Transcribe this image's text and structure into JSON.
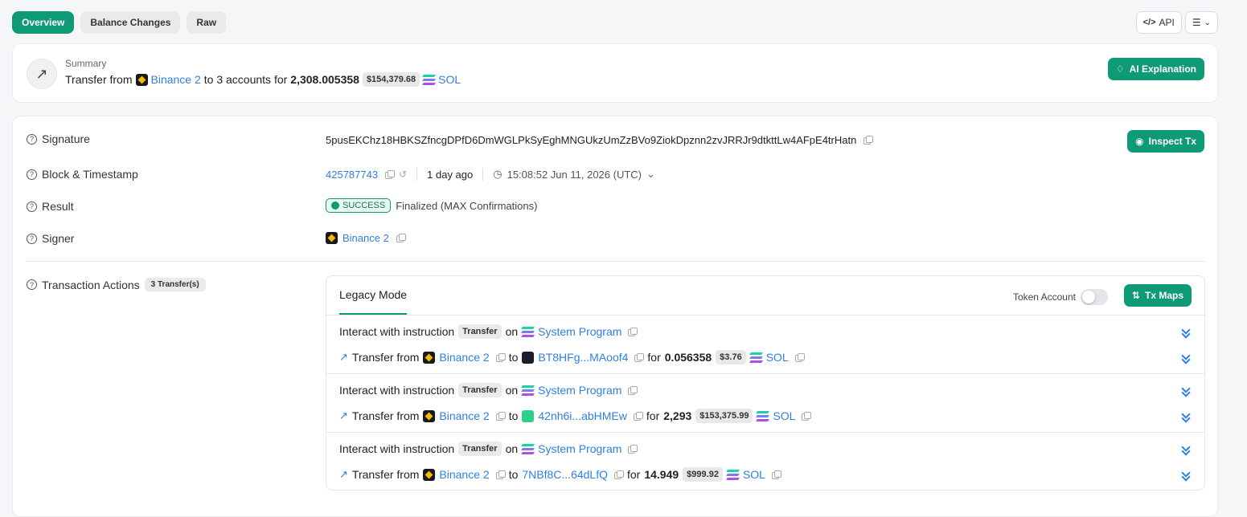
{
  "tabs": [
    "Overview",
    "Balance Changes",
    "Raw"
  ],
  "topright": {
    "api": "API"
  },
  "summary": {
    "label": "Summary",
    "prefix": "Transfer from",
    "from": "Binance 2",
    "mid": "to 3 accounts for",
    "amount": "2,308.005358",
    "usd": "$154,379.68",
    "token": "SOL",
    "ai_button": "AI Explanation"
  },
  "details": {
    "signature_label": "Signature",
    "signature": "5pusEKChz18HBKSZfncgDPfD6DmWGLPkSyEghMNGUkzUmZzBVo9ZiokDpznn2zvJRRJr9dtkttLw4AFpE4trHatn",
    "inspect_button": "Inspect Tx",
    "block_label": "Block & Timestamp",
    "block": "425787743",
    "ago": "1 day ago",
    "timestamp": "15:08:52 Jun 11, 2026 (UTC)",
    "result_label": "Result",
    "result": "SUCCESS",
    "finalized": "Finalized (MAX Confirmations)",
    "signer_label": "Signer",
    "signer": "Binance 2",
    "actions_label": "Transaction Actions",
    "actions_count": "3 Transfer(s)"
  },
  "actions": {
    "mode": "Legacy Mode",
    "token_account": "Token Account",
    "tx_maps": "Tx Maps",
    "interact_text": "Interact with instruction",
    "ins_badge": "Transfer",
    "on": "on",
    "program": "System Program",
    "transfer_from": "Transfer from",
    "to": "to",
    "for": "for",
    "items": [
      {
        "from": "Binance 2",
        "to": "BT8HFg...MAoof4",
        "amount": "0.056358",
        "usd": "$3.76",
        "token": "SOL",
        "to_color": "#1b1f2a"
      },
      {
        "from": "Binance 2",
        "to": "42nh6i...abHMEw",
        "amount": "2,293",
        "usd": "$153,375.99",
        "token": "SOL",
        "to_color": "#2bd08a"
      },
      {
        "from": "Binance 2",
        "to": "7NBf8C...64dLfQ",
        "amount": "14.949",
        "usd": "$999.92",
        "token": "SOL",
        "to_color": ""
      }
    ]
  }
}
